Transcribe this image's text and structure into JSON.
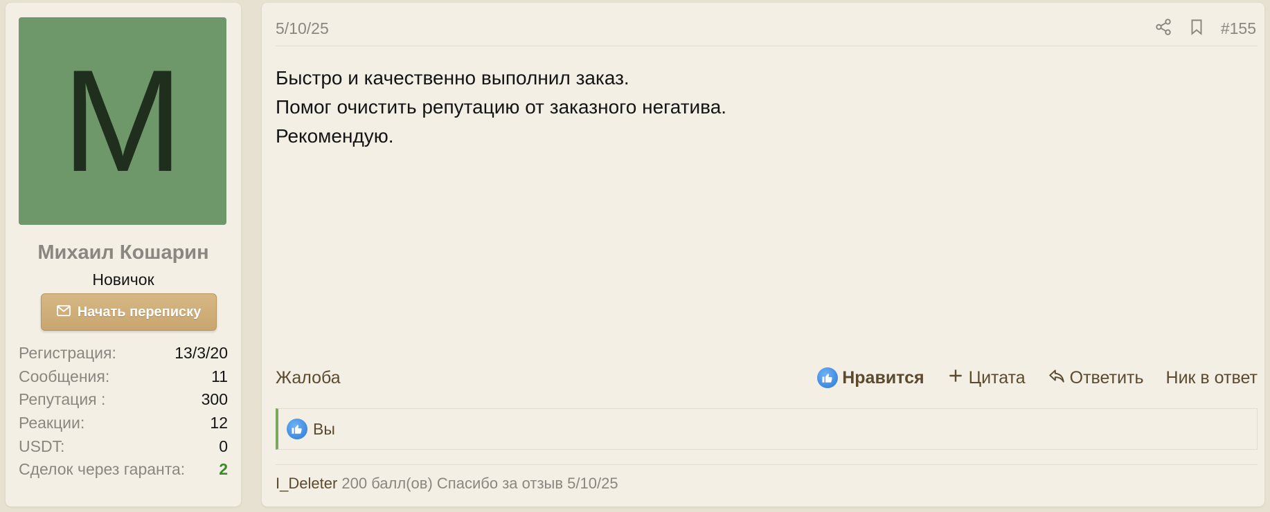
{
  "user": {
    "avatar_letter": "M",
    "avatar_color": "#6e9869",
    "name": "Михаил Кошарин",
    "title": "Новичок",
    "pm_button_label": "Начать переписку",
    "stats": [
      {
        "label": "Регистрация:",
        "value": "13/3/20"
      },
      {
        "label": "Сообщения:",
        "value": "11"
      },
      {
        "label": "Репутация :",
        "value": "300"
      },
      {
        "label": "Реакции:",
        "value": "12"
      },
      {
        "label": "USDT:",
        "value": "0"
      },
      {
        "label": "Сделок через гаранта:",
        "value": "2"
      }
    ]
  },
  "post": {
    "date": "5/10/25",
    "number": "#155",
    "lines": [
      "Быстро и качественно выполнил заказ.",
      "Помог очистить репутацию от заказного негатива.",
      "Рекомендую."
    ],
    "actions": {
      "report": "Жалоба",
      "like": "Нравится",
      "quote": "Цитата",
      "reply": "Ответить",
      "mention": "Ник в ответ"
    },
    "reactions_text": "Вы",
    "reputation": {
      "author": "I_Deleter",
      "text": "200 балл(ов) Спасибо за отзыв 5/10/25"
    }
  },
  "icons": {
    "share": "share-icon",
    "bookmark": "bookmark-icon",
    "envelope": "envelope-icon",
    "like": "thumbs-up-icon",
    "plus": "plus-icon",
    "reply": "reply-arrow-icon"
  },
  "colors": {
    "page_bg": "#e6e1d1",
    "panel_bg": "#f3efe4",
    "accent_button": "#c9a670",
    "link_brown": "#5c4a2e",
    "muted": "#8a8680",
    "green": "#3a8a2a"
  }
}
